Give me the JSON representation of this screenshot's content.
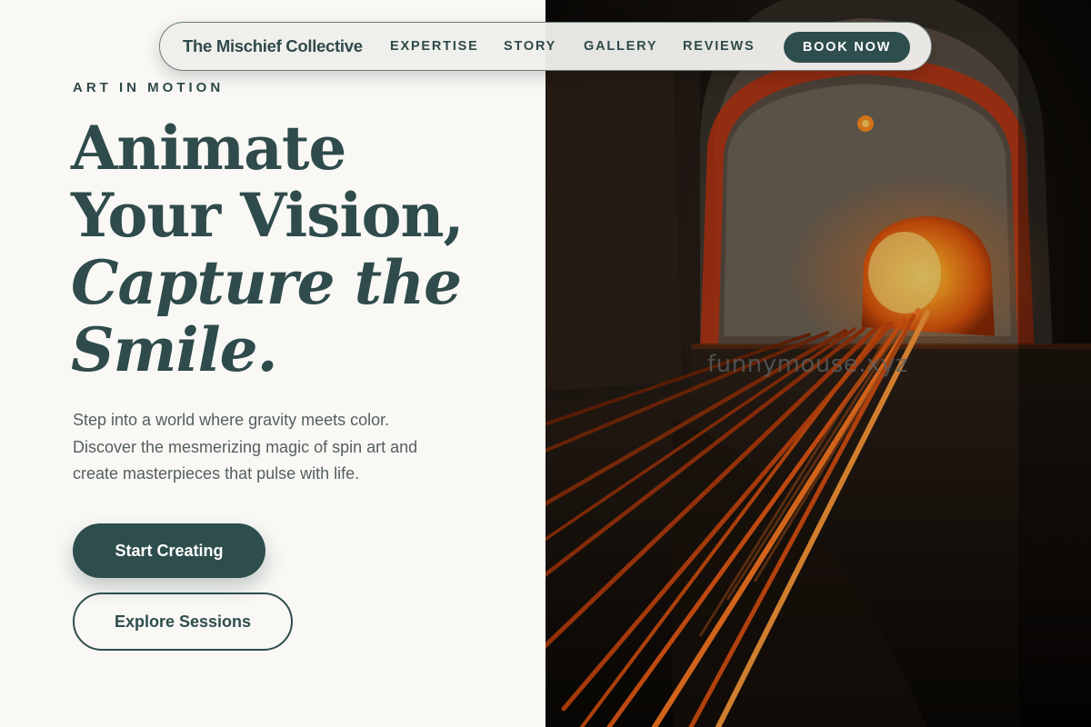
{
  "nav": {
    "brand": "The Mischief Collective",
    "links": [
      "EXPERTISE",
      "STORY",
      "GALLERY",
      "REVIEWS"
    ],
    "cta": "BOOK NOW"
  },
  "hero": {
    "eyebrow": "ART IN MOTION",
    "headline": {
      "line1": "Animate",
      "line2": "Your Vision,",
      "line3": "Capture the",
      "line4": "Smile."
    },
    "lede": {
      "line1": "Step into a world where gravity meets color.",
      "line2": "Discover the mesmerizing magic of spin art and",
      "line3": "create masterpieces that pulse with life."
    },
    "primary_button": "Start Creating",
    "secondary_button": "Explore Sessions"
  },
  "image": {
    "subject": "glowing furnace with metal rods",
    "watermark": "funnymouse.xyz"
  },
  "colors": {
    "accent": "#2e4d4d",
    "background": "#f9f8f5",
    "body_text": "#55605f",
    "glow": "#ff8a1e"
  }
}
